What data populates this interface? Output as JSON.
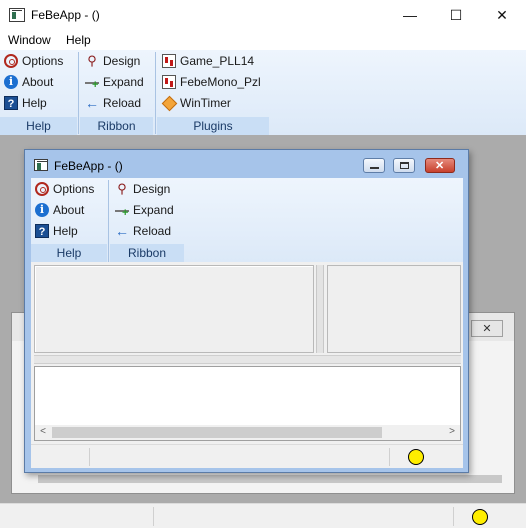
{
  "window": {
    "title": "FeBeApp -  ()",
    "minimize_glyph": "—",
    "maximize_glyph": "☐",
    "close_glyph": "✕"
  },
  "menu": {
    "items": [
      "Window",
      "Help"
    ]
  },
  "ribbon": {
    "groups": [
      {
        "label": "Help",
        "items": [
          {
            "label": "Options",
            "icon": "gear-icon"
          },
          {
            "label": "About",
            "icon": "info-icon"
          },
          {
            "label": "Help",
            "icon": "help-book-icon"
          }
        ]
      },
      {
        "label": "Ribbon",
        "items": [
          {
            "label": "Design",
            "icon": "wrench-icon"
          },
          {
            "label": "Expand",
            "icon": "expand-icon"
          },
          {
            "label": "Reload",
            "icon": "back-arrow-icon"
          }
        ]
      },
      {
        "label": "Plugins",
        "items": [
          {
            "label": "Game_PLL14",
            "icon": "cards-icon"
          },
          {
            "label": "FebeMono_Pzl",
            "icon": "cards-icon"
          },
          {
            "label": "WinTimer",
            "icon": "diamond-icon"
          }
        ]
      }
    ]
  },
  "inner_window": {
    "title": "FeBeApp -  ()",
    "ribbon": {
      "groups": [
        {
          "label": "Help",
          "items": [
            {
              "label": "Options"
            },
            {
              "label": "About"
            },
            {
              "label": "Help"
            }
          ]
        },
        {
          "label": "Ribbon",
          "items": [
            {
              "label": "Design"
            },
            {
              "label": "Expand"
            },
            {
              "label": "Reload"
            }
          ]
        }
      ]
    },
    "scroll_left_glyph": "<",
    "scroll_right_glyph": ">"
  },
  "background_window": {
    "close_glyph": "✕"
  },
  "colors": {
    "status_led": "#ffee00",
    "ribbon_accent": "#c9def5",
    "mdi_client": "#ababab"
  }
}
